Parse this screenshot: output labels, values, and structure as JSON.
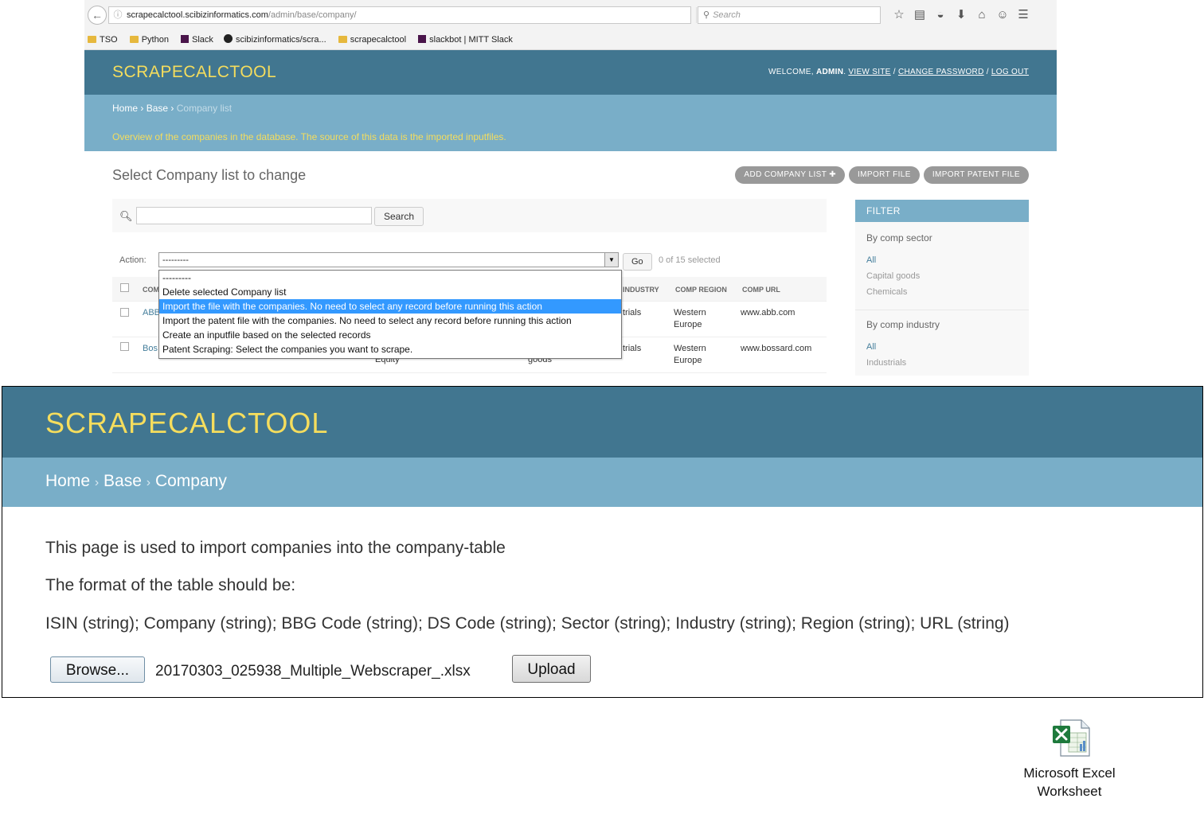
{
  "browser": {
    "url_domain": "scrapecalctool.scibizinformatics.com",
    "url_path": "/admin/base/company/",
    "search_placeholder": "Search",
    "bookmarks": [
      "TSO",
      "Python",
      "Slack",
      "scibizinformatics/scra...",
      "scrapecalctool",
      "slackbot | MITT Slack"
    ]
  },
  "admin_list": {
    "brand": "SCRAPECALCTOOL",
    "user_tools": {
      "welcome": "WELCOME,",
      "user": "ADMIN",
      "view_site": "VIEW SITE",
      "change_password": "CHANGE PASSWORD",
      "log_out": "LOG OUT",
      "separator": "/"
    },
    "breadcrumbs": {
      "home": "Home",
      "base": "Base",
      "current": "Company list",
      "sep": "›"
    },
    "description": "Overview of the companies in the database. The source of this data is the imported inputfiles.",
    "title": "Select Company list to change",
    "object_tools": {
      "add": "ADD COMPANY LIST ✚",
      "import": "IMPORT FILE",
      "import_patent": "IMPORT PATENT FILE"
    },
    "search_button": "Search",
    "action_label": "Action:",
    "action_selected": "---------",
    "go_button": "Go",
    "selected_count": "0 of 15 selected",
    "columns": {
      "comp": "COM",
      "industry": "INDUSTRY",
      "region": "COMP REGION",
      "url": "COMP URL"
    },
    "rows": [
      {
        "name": "ABB",
        "industry": "trials",
        "region1": "Western",
        "region2": "Europe",
        "url": "www.abb.com",
        "extra1": "",
        "extra2": ""
      },
      {
        "name": "Bos",
        "industry": "trials",
        "region1": "Western",
        "region2": "Europe",
        "url": "www.bossard.com",
        "extra1": "Equity",
        "extra2": "goods"
      }
    ],
    "dropdown_options": [
      "---------",
      "Delete selected Company list",
      "Import the file with the companies. No need to select any record before running this action",
      "Import the patent file with the companies. No need to select any record before running this action",
      "Create an inputfile based on the selected records",
      "Patent Scraping: Select the companies you want to scrape."
    ],
    "filter": {
      "header": "FILTER",
      "groups": [
        {
          "title": "By comp sector",
          "all": "All",
          "options": [
            "Capital goods",
            "Chemicals"
          ]
        },
        {
          "title": "By comp industry",
          "all": "All",
          "options": [
            "Industrials"
          ]
        }
      ]
    }
  },
  "import_page": {
    "brand": "SCRAPECALCTOOL",
    "breadcrumbs": {
      "home": "Home",
      "base": "Base",
      "current": "Company",
      "sep": "›"
    },
    "line1": "This page is used to import companies into the company-table",
    "line2": "The format of the table should be:",
    "line3": "ISIN (string); Company (string); BBG Code (string); DS Code (string); Sector (string); Industry (string); Region (string); URL (string)",
    "browse_button": "Browse...",
    "filename": "20170303_025938_Multiple_Webscraper_.xlsx",
    "upload_button": "Upload"
  },
  "attachment": {
    "label_line1": "Microsoft Excel",
    "label_line2": "Worksheet",
    "icon": "excel-file-icon"
  },
  "colors": {
    "header": "#417690",
    "crumbs": "#79aec8",
    "brand": "#f5dd5d",
    "highlight": "#3399ff"
  }
}
